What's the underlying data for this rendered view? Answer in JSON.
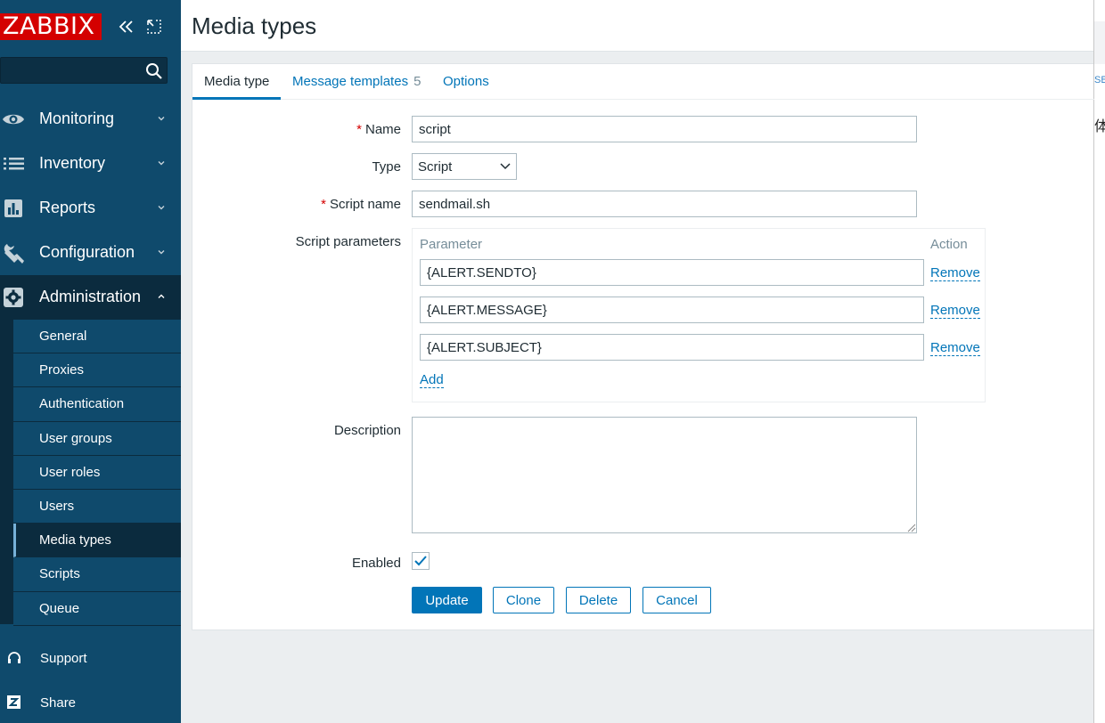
{
  "sidebar": {
    "logo": "ZABBIX",
    "search": {
      "value": "",
      "placeholder": ""
    },
    "menu": [
      {
        "label": "Monitoring",
        "icon": "eye-icon"
      },
      {
        "label": "Inventory",
        "icon": "list-icon"
      },
      {
        "label": "Reports",
        "icon": "bar-chart-icon"
      },
      {
        "label": "Configuration",
        "icon": "wrench-icon"
      },
      {
        "label": "Administration",
        "icon": "gear-icon"
      }
    ],
    "submenu": [
      "General",
      "Proxies",
      "Authentication",
      "User groups",
      "User roles",
      "Users",
      "Media types",
      "Scripts",
      "Queue"
    ],
    "bottom": [
      {
        "label": "Support",
        "icon": "headset-icon"
      },
      {
        "label": "Share",
        "icon": "share-z-icon"
      }
    ]
  },
  "header": {
    "title": "Media types"
  },
  "tabs": {
    "media_type": "Media type",
    "message_templates": "Message templates",
    "message_templates_count": "5",
    "options": "Options"
  },
  "form": {
    "name_label": "Name",
    "name_value": "script",
    "type_label": "Type",
    "type_value": "Script",
    "script_name_label": "Script name",
    "script_name_value": "sendmail.sh",
    "script_params_label": "Script parameters",
    "params_header_parameter": "Parameter",
    "params_header_action": "Action",
    "params": [
      "{ALERT.SENDTO}",
      "{ALERT.MESSAGE}",
      "{ALERT.SUBJECT}"
    ],
    "remove_label": "Remove",
    "add_label": "Add",
    "description_label": "Description",
    "description_value": "",
    "enabled_label": "Enabled",
    "enabled": true
  },
  "buttons": {
    "update": "Update",
    "clone": "Clone",
    "delete": "Delete",
    "cancel": "Cancel"
  },
  "colors": {
    "sidebar": "#0f4a6c",
    "accent": "#0275b8",
    "logo": "#d40000"
  },
  "right_strip": {
    "g1": "SB",
    "g2": "体"
  }
}
